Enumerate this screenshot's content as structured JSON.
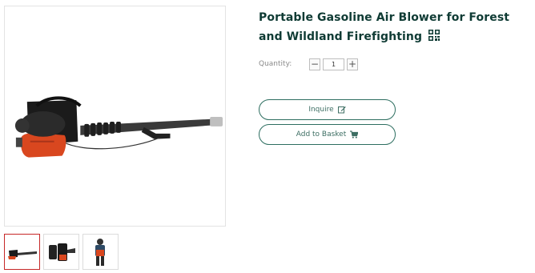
{
  "product": {
    "title": "Portable Gasoline Air Blower for Forest and Wildland Firefighting",
    "quantity_label": "Quantity:",
    "quantity_value": "1",
    "decrement_label": "−",
    "increment_label": "+",
    "inquire_label": "Inquire",
    "basket_label": "Add to Basket"
  },
  "icons": {
    "qr": "qr-code-icon",
    "inquire": "edit-icon",
    "basket": "cart-icon"
  },
  "colors": {
    "title": "#0f3b34",
    "button_border": "#2d6e60",
    "button_text": "#3d6e63",
    "active_thumb": "#c62828",
    "engine": "#d9471f"
  },
  "thumbnails": [
    {
      "name": "blower-side-view",
      "active": true
    },
    {
      "name": "blower-back-view",
      "active": false
    },
    {
      "name": "operator-wearing-blower",
      "active": false
    }
  ]
}
